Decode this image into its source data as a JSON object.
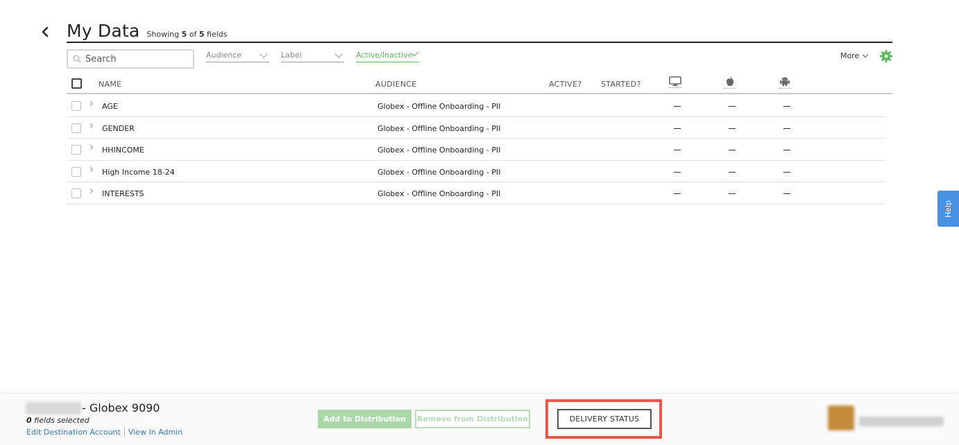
{
  "header": {
    "title": "My Data",
    "showing_prefix": "Showing",
    "showing_count": "5",
    "showing_of": "of",
    "showing_total": "5",
    "showing_suffix": "fields"
  },
  "toolbar": {
    "search_placeholder": "Search",
    "filters": [
      {
        "label": "Audience"
      },
      {
        "label": "Label"
      },
      {
        "label": "Active/Inactive"
      }
    ],
    "more_label": "More",
    "accent_color": "#5cb85c"
  },
  "table": {
    "columns": [
      "NAME",
      "AUDIENCE",
      "ACTIVE?",
      "STARTED?"
    ],
    "platform_icons": [
      "desktop-icon",
      "apple-icon",
      "android-icon"
    ],
    "rows": [
      {
        "name": "AGE",
        "audience": "Globex - Offline Onboarding - PII"
      },
      {
        "name": "GENDER",
        "audience": "Globex - Offline Onboarding - PII"
      },
      {
        "name": "HHINCOME",
        "audience": "Globex - Offline Onboarding - PII"
      },
      {
        "name": "High Income 18-24",
        "audience": "Globex - Offline Onboarding - PII"
      },
      {
        "name": "INTERESTS",
        "audience": "Globex - Offline Onboarding - PII"
      }
    ]
  },
  "help": {
    "label": "Help",
    "color": "#4a90e2"
  },
  "footer": {
    "account_name": "- Globex 9090",
    "selected_count": "0",
    "selected_suffix": "fields selected",
    "edit_link": "Edit Destination Account",
    "admin_link": "View In Admin",
    "add_button": "Add to Distribution",
    "remove_button": "Remove from Distribution",
    "delivery_button": "DELIVERY STATUS",
    "highlight_color": "#e8574a"
  }
}
